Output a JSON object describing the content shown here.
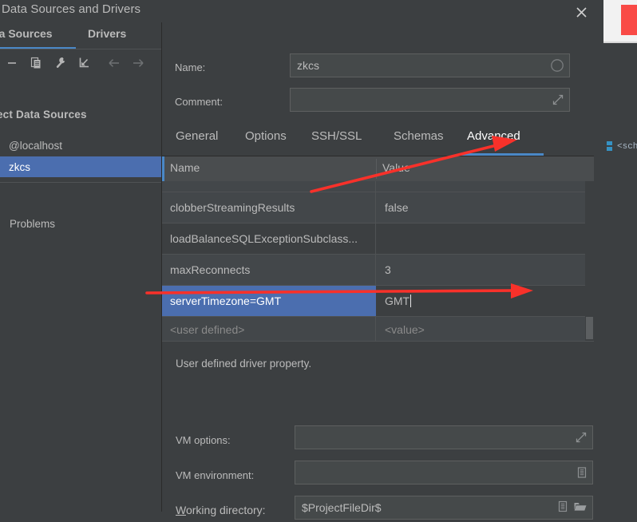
{
  "dialog": {
    "title": "Data Sources and Drivers",
    "close_icon": "close-icon"
  },
  "sidebar": {
    "tabs": [
      {
        "label": "ta Sources",
        "selected": true
      },
      {
        "label": "Drivers",
        "selected": false
      }
    ],
    "toolbar": [
      {
        "name": "remove-icon",
        "glyph": "minus"
      },
      {
        "name": "copy-icon",
        "glyph": "copy"
      },
      {
        "name": "wrench-icon",
        "glyph": "wrench"
      },
      {
        "name": "import-icon",
        "glyph": "import-arrow"
      },
      {
        "name": "back-arrow-icon",
        "glyph": "arrow-left"
      },
      {
        "name": "forward-arrow-icon",
        "glyph": "arrow-right"
      }
    ],
    "tree": {
      "group_label": "ject Data Sources",
      "items": [
        {
          "label": "@localhost",
          "selected": false
        },
        {
          "label": "zkcs",
          "selected": true
        }
      ]
    },
    "problems_label": "Problems"
  },
  "content": {
    "name_label": "Name:",
    "name_value": "zkcs",
    "comment_label": "Comment:",
    "comment_value": "",
    "tabs": [
      {
        "label": "General",
        "selected": false
      },
      {
        "label": "Options",
        "selected": false
      },
      {
        "label": "SSH/SSL",
        "selected": false
      },
      {
        "label": "Schemas",
        "selected": false
      },
      {
        "label": "Advanced",
        "selected": true
      }
    ],
    "table": {
      "columns": [
        "Name",
        "Value"
      ],
      "rows": [
        {
          "name": "clobberStreamingResults",
          "value": "false",
          "selected": false
        },
        {
          "name": "loadBalanceSQLExceptionSubclass...",
          "value": "",
          "selected": false
        },
        {
          "name": "maxReconnects",
          "value": "3",
          "selected": false
        },
        {
          "name": "serverTimezone=GMT",
          "value": "GMT",
          "selected": true,
          "editing": true
        },
        {
          "name": "<user defined>",
          "value": "<value>",
          "selected": false,
          "placeholder": true
        }
      ]
    },
    "description": "User defined driver property.",
    "vm_options_label": "VM options:",
    "vm_options_value": "",
    "vm_environment_label": "VM environment:",
    "vm_environment_value": "",
    "working_directory_label_mnemonic": "W",
    "working_directory_label_rest": "orking directory:",
    "working_directory_value": "$ProjectFileDir$"
  },
  "background": {
    "schema_label": "<sch"
  },
  "colors": {
    "dialog_bg": "#3c3f41",
    "selection_blue": "#4b6eaf",
    "accent_blue": "#4a88c7",
    "annotation_red": "#f8312a",
    "text": "#bbbbbb",
    "placeholder_text": "#8a8a8a",
    "field_bg": "#45494a",
    "red_block": "#f94a46",
    "schema_icon": "#3592c4"
  }
}
